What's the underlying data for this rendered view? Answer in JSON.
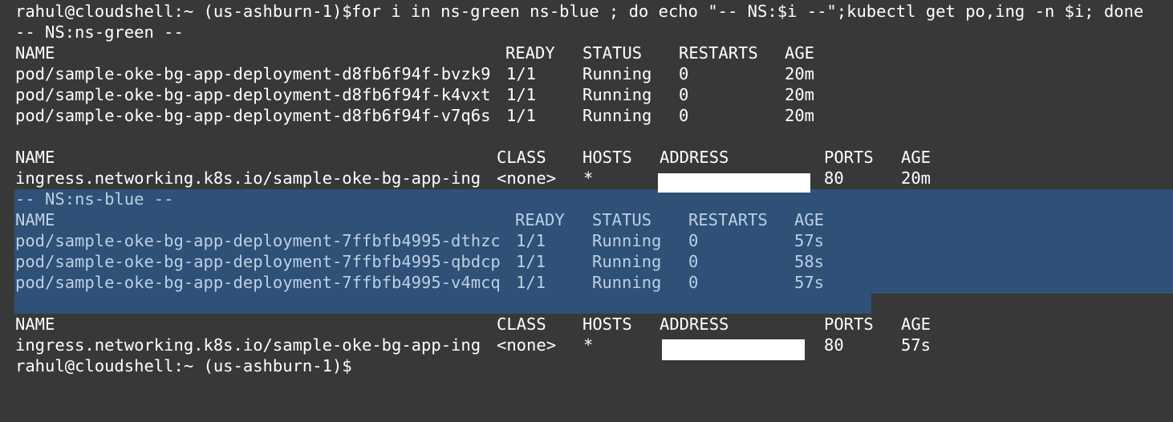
{
  "terminal": {
    "command_line": {
      "prompt": "rahul@cloudshell:~ (us-ashburn-1)$",
      "command": "for i in ns-green ns-blue ; do echo \"-- NS:$i --\";kubectl get po,ing -n $i; done"
    },
    "namespaces": [
      {
        "header": "-- NS:ns-green --",
        "pods": {
          "columns": [
            "NAME",
            "READY",
            "STATUS",
            "RESTARTS",
            "AGE"
          ],
          "rows": [
            [
              "pod/sample-oke-bg-app-deployment-d8fb6f94f-bvzk9",
              "1/1",
              "Running",
              "0",
              "20m"
            ],
            [
              "pod/sample-oke-bg-app-deployment-d8fb6f94f-k4vxt",
              "1/1",
              "Running",
              "0",
              "20m"
            ],
            [
              "pod/sample-oke-bg-app-deployment-d8fb6f94f-v7q6s",
              "1/1",
              "Running",
              "0",
              "20m"
            ]
          ]
        },
        "ingress": {
          "columns": [
            "NAME",
            "CLASS",
            "HOSTS",
            "ADDRESS",
            "PORTS",
            "AGE"
          ],
          "rows": [
            [
              "ingress.networking.k8s.io/sample-oke-bg-app-ing",
              "<none>",
              "*",
              "",
              "80",
              "20m"
            ]
          ]
        }
      },
      {
        "header": "-- NS:ns-blue --",
        "pods": {
          "columns": [
            "NAME",
            "READY",
            "STATUS",
            "RESTARTS",
            "AGE"
          ],
          "rows": [
            [
              "pod/sample-oke-bg-app-deployment-7ffbfb4995-dthzc",
              "1/1",
              "Running",
              "0",
              "57s"
            ],
            [
              "pod/sample-oke-bg-app-deployment-7ffbfb4995-qbdcp",
              "1/1",
              "Running",
              "0",
              "58s"
            ],
            [
              "pod/sample-oke-bg-app-deployment-7ffbfb4995-v4mcq",
              "1/1",
              "Running",
              "0",
              "57s"
            ]
          ]
        },
        "ingress": {
          "columns": [
            "NAME",
            "CLASS",
            "HOSTS",
            "ADDRESS",
            "PORTS",
            "AGE"
          ],
          "rows": [
            [
              "ingress.networking.k8s.io/sample-oke-bg-app-ing",
              "<none>",
              "*",
              "",
              "80",
              "57s"
            ]
          ]
        }
      }
    ],
    "final_prompt": "rahul@cloudshell:~ (us-ashburn-1)$",
    "colors": {
      "background": "#383838",
      "text": "#ffffff",
      "selection": "#2f5077",
      "selected_text": "#bcd0e4",
      "redaction": "#ffffff"
    }
  }
}
